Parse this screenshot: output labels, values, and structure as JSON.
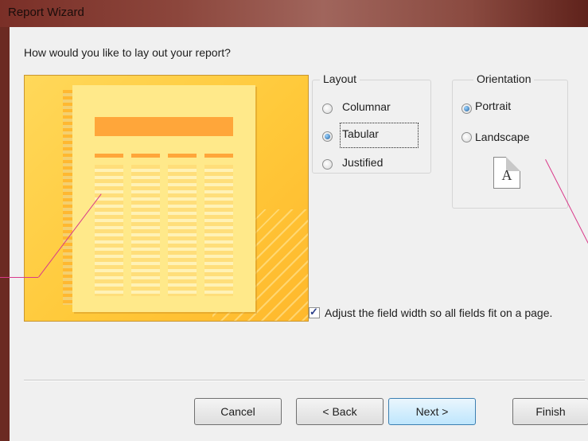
{
  "window": {
    "title": "Report Wizard"
  },
  "question": "How would you like to lay out your report?",
  "layout": {
    "legend": "Layout",
    "options": [
      {
        "label": "Columnar",
        "selected": false
      },
      {
        "label": "Tabular",
        "selected": true
      },
      {
        "label": "Justified",
        "selected": false
      }
    ]
  },
  "orientation": {
    "legend": "Orientation",
    "options": [
      {
        "label": "Portrait",
        "selected": true
      },
      {
        "label": "Landscape",
        "selected": false
      }
    ],
    "icon_letter": "A"
  },
  "adjust_width": {
    "label": "Adjust the field width so all fields fit on a page.",
    "checked": true
  },
  "buttons": {
    "cancel": "Cancel",
    "back": "< Back",
    "next": "Next >",
    "finish": "Finish"
  },
  "colors": {
    "accent_pointer": "#d93a8a",
    "preview_bg": "#ffc93a",
    "preview_header": "#ffa63a"
  }
}
